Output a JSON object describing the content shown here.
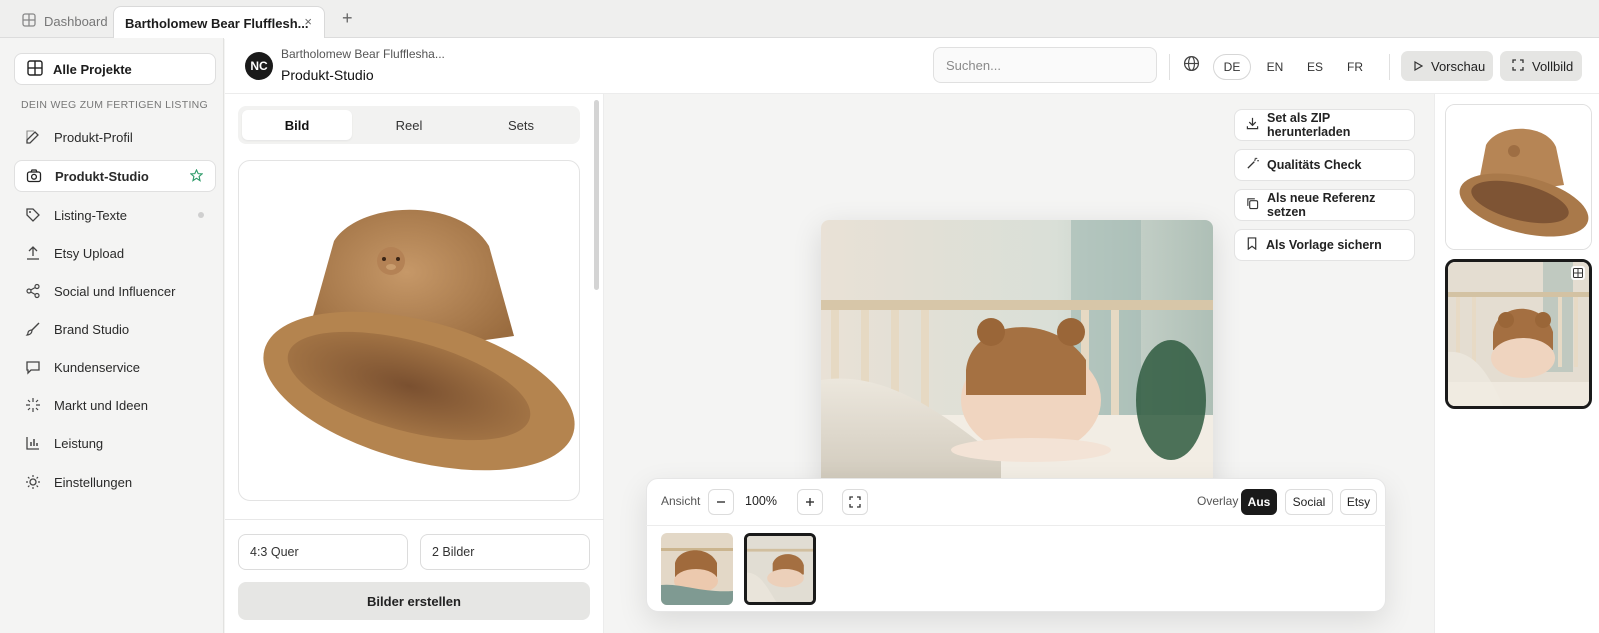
{
  "tabs": {
    "dashboard_label": "Dashboard",
    "active_label": "Bartholomew Bear Flufflesh...",
    "close_glyph": "×",
    "add_glyph": "+"
  },
  "sidebar": {
    "top_item": "Alle Projekte",
    "section_label": "DEIN WEG ZUM FERTIGEN LISTING",
    "items": [
      {
        "label": "Produkt-Profil",
        "icon": "edit-icon"
      },
      {
        "label": "Produkt-Studio",
        "icon": "camera-icon",
        "active": true,
        "trail": "star-icon"
      },
      {
        "label": "Listing-Texte",
        "icon": "tag-icon",
        "trail": "dot"
      },
      {
        "label": "Etsy Upload",
        "icon": "upload-icon"
      },
      {
        "label": "Social und Influencer",
        "icon": "share-icon"
      },
      {
        "label": "Brand Studio",
        "icon": "brush-icon"
      },
      {
        "label": "Kundenservice",
        "icon": "chat-icon"
      },
      {
        "label": "Markt und Ideen",
        "icon": "sparkle-icon"
      },
      {
        "label": "Leistung",
        "icon": "bar-chart-icon"
      },
      {
        "label": "Einstellungen",
        "icon": "sun-gear-icon"
      }
    ]
  },
  "header": {
    "logo_initials": "NC",
    "project_name": "Bartholomew Bear Fluffleshа...",
    "page_title": "Produkt-Studio",
    "search_placeholder": "Suchen...",
    "languages": [
      "DE",
      "EN",
      "ES",
      "FR"
    ],
    "active_language": "DE",
    "preview_label": "Vorschau",
    "fullscreen_label": "Vollbild"
  },
  "left_panel": {
    "segments": [
      "Bild",
      "Reel",
      "Sets"
    ],
    "active_segment": "Bild",
    "format_value": "4:3 Quer",
    "count_value": "2 Bilder",
    "create_label": "Bilder erstellen"
  },
  "actions": [
    {
      "label": "Set als ZIP herunterladen",
      "icon": "download-icon"
    },
    {
      "label": "Qualitäts Check",
      "icon": "magic-wand-icon"
    },
    {
      "label": "Als neue Referenz setzen",
      "icon": "copy-icon"
    },
    {
      "label": "Als Vorlage sichern",
      "icon": "bookmark-icon"
    }
  ],
  "toolbar": {
    "view_label": "Ansicht",
    "zoom_value": "100%",
    "overlay_label": "Overlay",
    "overlay_options": [
      "Aus",
      "Social",
      "Etsy"
    ],
    "overlay_active": "Aus"
  },
  "colors": {
    "accent_dark": "#1a1a1a",
    "star_green": "#2e9b6a",
    "hat_brown": "#a97a4b"
  }
}
